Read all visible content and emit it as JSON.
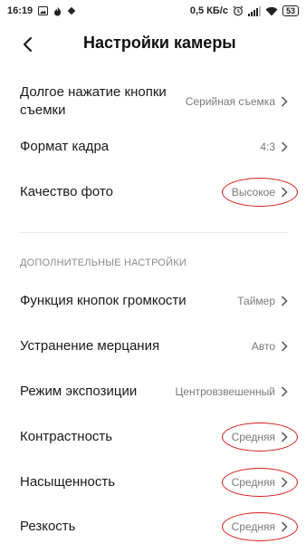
{
  "status_bar": {
    "time": "16:19",
    "net_speed": "0,5 КБ/с",
    "battery": "53"
  },
  "header": {
    "title": "Настройки камеры"
  },
  "settings": [
    {
      "label": "Долгое нажатие кнопки съемки",
      "value": "Серийная съемка",
      "highlighted": false
    },
    {
      "label": "Формат кадра",
      "value": "4:3",
      "highlighted": false
    },
    {
      "label": "Качество фото",
      "value": "Высокое",
      "highlighted": true
    }
  ],
  "section_header": "ДОПОЛНИТЕЛЬНЫЕ НАСТРОЙКИ",
  "advanced_settings": [
    {
      "label": "Функция кнопок громкости",
      "value": "Таймер",
      "highlighted": false
    },
    {
      "label": "Устранение мерцания",
      "value": "Авто",
      "highlighted": false
    },
    {
      "label": "Режим экспозиции",
      "value": "Центровзвешенный",
      "highlighted": false
    },
    {
      "label": "Контрастность",
      "value": "Средняя",
      "highlighted": true
    },
    {
      "label": "Насыщенность",
      "value": "Средняя",
      "highlighted": true
    },
    {
      "label": "Резкость",
      "value": "Средняя",
      "highlighted": true
    }
  ],
  "colors": {
    "highlight_ellipse": "#d81b1b",
    "value_text": "#7a7a7a"
  }
}
